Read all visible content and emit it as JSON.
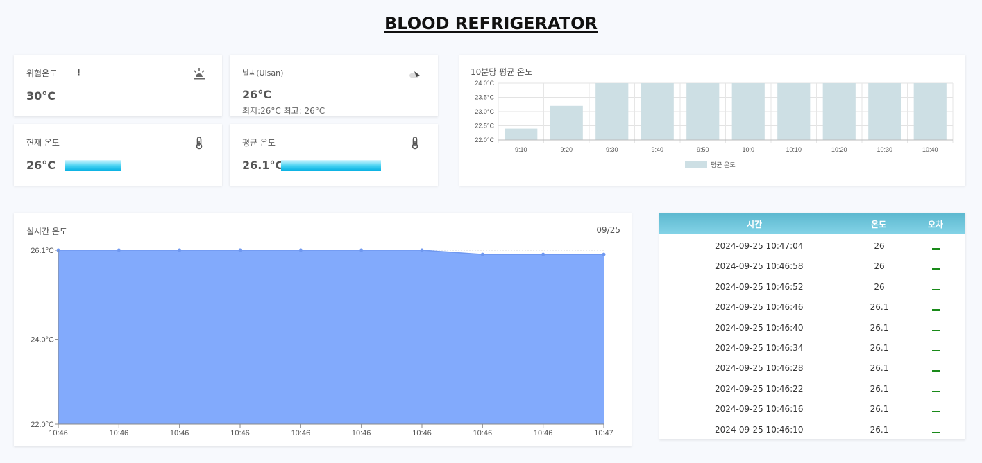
{
  "header": {
    "title": "BLOOD REFRIGERATOR"
  },
  "cards": {
    "danger": {
      "label": "위험온도",
      "value": "30°C",
      "icon": "alarm-light-icon"
    },
    "weather": {
      "label": "날씨(Ulsan)",
      "value": "26°C",
      "sub": "최저:26°C 최고: 26°C",
      "icon": "weather-cloud-icon"
    },
    "current": {
      "label": "현재 온도",
      "value": "26°C",
      "icon": "thermometer-icon",
      "level_fraction": 0.8
    },
    "average": {
      "label": "평균 온도",
      "value": "26.1°C",
      "icon": "thermometer-icon",
      "level_fraction": 0.8
    }
  },
  "bar_chart": {
    "chart_data": {
      "type": "bar",
      "title": "10분당 평균 온도",
      "categories": [
        "9:10",
        "9:20",
        "9:30",
        "9:40",
        "9:50",
        "10:0",
        "10:10",
        "10:20",
        "10:30",
        "10:40"
      ],
      "series": [
        {
          "name": "평균 온도",
          "values": [
            22.4,
            23.2,
            24.0,
            24.0,
            24.0,
            24.0,
            24.0,
            24.0,
            24.0,
            24.0
          ]
        }
      ],
      "ylim": [
        22.0,
        24.0
      ],
      "yticks": [
        "22.0°C",
        "22.5°C",
        "23.0°C",
        "23.5°C",
        "24.0°C"
      ],
      "color": "#cddfe4",
      "legend": "bottom"
    }
  },
  "line_chart": {
    "date": "09/25",
    "chart_data": {
      "type": "area",
      "title": "실시간 온도",
      "categories": [
        "10:46",
        "10:46",
        "10:46",
        "10:46",
        "10:46",
        "10:46",
        "10:46",
        "10:46",
        "10:46",
        "10:47"
      ],
      "values": [
        26.1,
        26.1,
        26.1,
        26.1,
        26.1,
        26.1,
        26.1,
        26.0,
        26.0,
        26.0
      ],
      "ylim": [
        22.0,
        26.1
      ],
      "yticks": [
        {
          "value": 22.0,
          "label": "22.0°C"
        },
        {
          "value": 24.0,
          "label": "24.0°C"
        },
        {
          "value": 26.1,
          "label": "26.1°C"
        }
      ],
      "fill": "#82aafc",
      "line": "#6f98f0"
    }
  },
  "table": {
    "headers": [
      "시간",
      "온도",
      "오차"
    ],
    "rows": [
      {
        "time": "2024-09-25 10:47:04",
        "temp": "26"
      },
      {
        "time": "2024-09-25 10:46:58",
        "temp": "26"
      },
      {
        "time": "2024-09-25 10:46:52",
        "temp": "26"
      },
      {
        "time": "2024-09-25 10:46:46",
        "temp": "26.1"
      },
      {
        "time": "2024-09-25 10:46:40",
        "temp": "26.1"
      },
      {
        "time": "2024-09-25 10:46:34",
        "temp": "26.1"
      },
      {
        "time": "2024-09-25 10:46:28",
        "temp": "26.1"
      },
      {
        "time": "2024-09-25 10:46:22",
        "temp": "26.1"
      },
      {
        "time": "2024-09-25 10:46:16",
        "temp": "26.1"
      },
      {
        "time": "2024-09-25 10:46:10",
        "temp": "26.1"
      }
    ]
  }
}
